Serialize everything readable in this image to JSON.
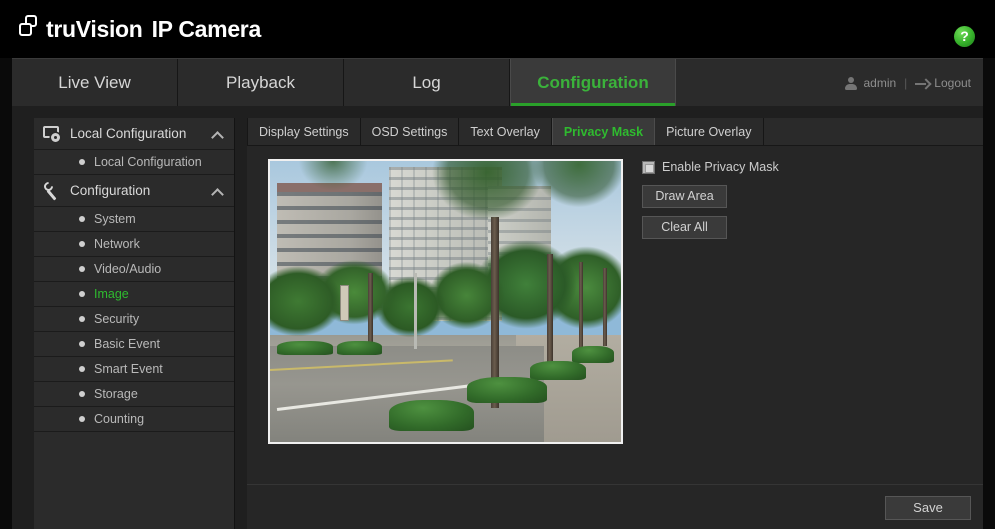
{
  "header": {
    "brand_name": "truVision",
    "product": "IP Camera",
    "logo_icon": "overlapping-squares-logo",
    "help_icon": "question-mark-help-icon",
    "help_label": "?"
  },
  "nav": {
    "tabs": [
      {
        "label": "Live View",
        "active": false
      },
      {
        "label": "Playback",
        "active": false
      },
      {
        "label": "Log",
        "active": false
      },
      {
        "label": "Configuration",
        "active": true
      }
    ],
    "user": {
      "user_icon": "user-icon",
      "username": "admin",
      "separator": "|",
      "logout_icon": "logout-arrow-icon",
      "logout_label": "Logout"
    }
  },
  "sidebar": {
    "groups": [
      {
        "title": "Local Configuration",
        "icon": "monitor-gear-icon",
        "chevron": "chevron-up-icon",
        "items": [
          {
            "label": "Local Configuration",
            "active": false
          }
        ]
      },
      {
        "title": "Configuration",
        "icon": "wrench-icon",
        "chevron": "chevron-up-icon",
        "items": [
          {
            "label": "System",
            "active": false
          },
          {
            "label": "Network",
            "active": false
          },
          {
            "label": "Video/Audio",
            "active": false
          },
          {
            "label": "Image",
            "active": true
          },
          {
            "label": "Security",
            "active": false
          },
          {
            "label": "Basic Event",
            "active": false
          },
          {
            "label": "Smart Event",
            "active": false
          },
          {
            "label": "Storage",
            "active": false
          },
          {
            "label": "Counting",
            "active": false
          }
        ]
      }
    ]
  },
  "content": {
    "tabs": [
      {
        "label": "Display Settings",
        "active": false
      },
      {
        "label": "OSD Settings",
        "active": false
      },
      {
        "label": "Text Overlay",
        "active": false
      },
      {
        "label": "Privacy Mask",
        "active": true
      },
      {
        "label": "Picture Overlay",
        "active": false
      }
    ],
    "preview": {
      "name": "live-video-preview",
      "description": "Street scene with apartment buildings, trees and a road"
    },
    "controls": {
      "enable_privacy_mask_label": "Enable Privacy Mask",
      "enable_privacy_mask_checked": false,
      "draw_area_label": "Draw Area",
      "clear_all_label": "Clear All"
    },
    "footer": {
      "save_label": "Save"
    }
  },
  "colors": {
    "accent_green": "#2fbb2f",
    "header_bg": "#000000",
    "nav_bg": "#2b2b2b",
    "panel_bg": "#262626",
    "sidebar_bg": "#2b2b2b",
    "text_primary": "#d6d6d6",
    "text_muted": "#8e8e8e"
  }
}
